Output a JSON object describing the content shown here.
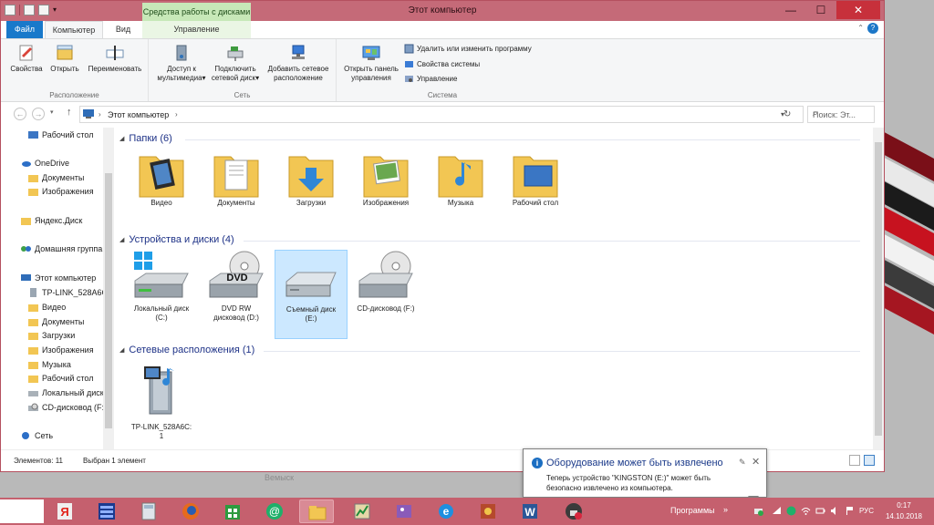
{
  "window": {
    "title": "Этот компьютер",
    "context_tab_group": "Средства работы с дисками",
    "colors": {
      "frame": "#c56a78",
      "accent": "#1979ca",
      "selection": "#cce8ff",
      "close": "#c7303b"
    }
  },
  "ribbon_tabs": {
    "file": "Файл",
    "computer": "Компьютер",
    "view": "Вид",
    "manage": "Управление"
  },
  "ribbon": {
    "location": {
      "label": "Расположение",
      "properties": "Свойства",
      "open": "Открыть",
      "rename": "Переименовать"
    },
    "network": {
      "label": "Сеть",
      "media_access_1": "Доступ к",
      "media_access_2": "мультимедиа",
      "map_drive_1": "Подключить",
      "map_drive_2": "сетевой диск",
      "add_location_1": "Добавить сетевое",
      "add_location_2": "расположение"
    },
    "system": {
      "label": "Система",
      "control_panel_1": "Открыть панель",
      "control_panel_2": "управления",
      "uninstall": "Удалить или изменить программу",
      "system_properties": "Свойства системы",
      "manage": "Управление"
    }
  },
  "address_bar": {
    "crumb": "Этот компьютер",
    "search_placeholder": "Поиск: Эт..."
  },
  "nav_pane": {
    "items": [
      "Рабочий стол",
      "OneDrive",
      "Документы",
      "Изображения",
      "Яндекс.Диск",
      "Домашняя группа",
      "Этот компьютер",
      "TP-LINK_528A6C",
      "Видео",
      "Документы",
      "Загрузки",
      "Изображения",
      "Музыка",
      "Рабочий стол",
      "Локальный диск",
      "CD-дисковод (F:",
      "Сеть"
    ]
  },
  "content": {
    "folders_header": "Папки (6)",
    "folders": [
      "Видео",
      "Документы",
      "Загрузки",
      "Изображения",
      "Музыка",
      "Рабочий стол"
    ],
    "devices_header": "Устройства и диски (4)",
    "devices": [
      {
        "line1": "Локальный диск",
        "line2": "(C:)"
      },
      {
        "line1": "DVD RW",
        "line2": "дисковод (D:)",
        "disc_label": "DVD"
      },
      {
        "line1": "Съемный диск",
        "line2": "(E:)"
      },
      {
        "line1": "CD-дисковод (F:)",
        "line2": ""
      }
    ],
    "network_header": "Сетевые расположения (1)",
    "network_items": [
      {
        "line1": "TP-LINK_528A6C:",
        "line2": "1"
      }
    ]
  },
  "status_bar": {
    "items_count": "Элементов: 11",
    "selected": "Выбран 1 элемент"
  },
  "background_text": "Вемыск",
  "notification": {
    "title": "Оборудование может быть извлечено",
    "body": "Теперь устройство \"KINGSTON (E:)\" может быть безопасно извлечено из компьютера."
  },
  "taskbar": {
    "programs": "Программы",
    "lang": "РУС",
    "time": "0:17",
    "date": "14.10.2018"
  }
}
